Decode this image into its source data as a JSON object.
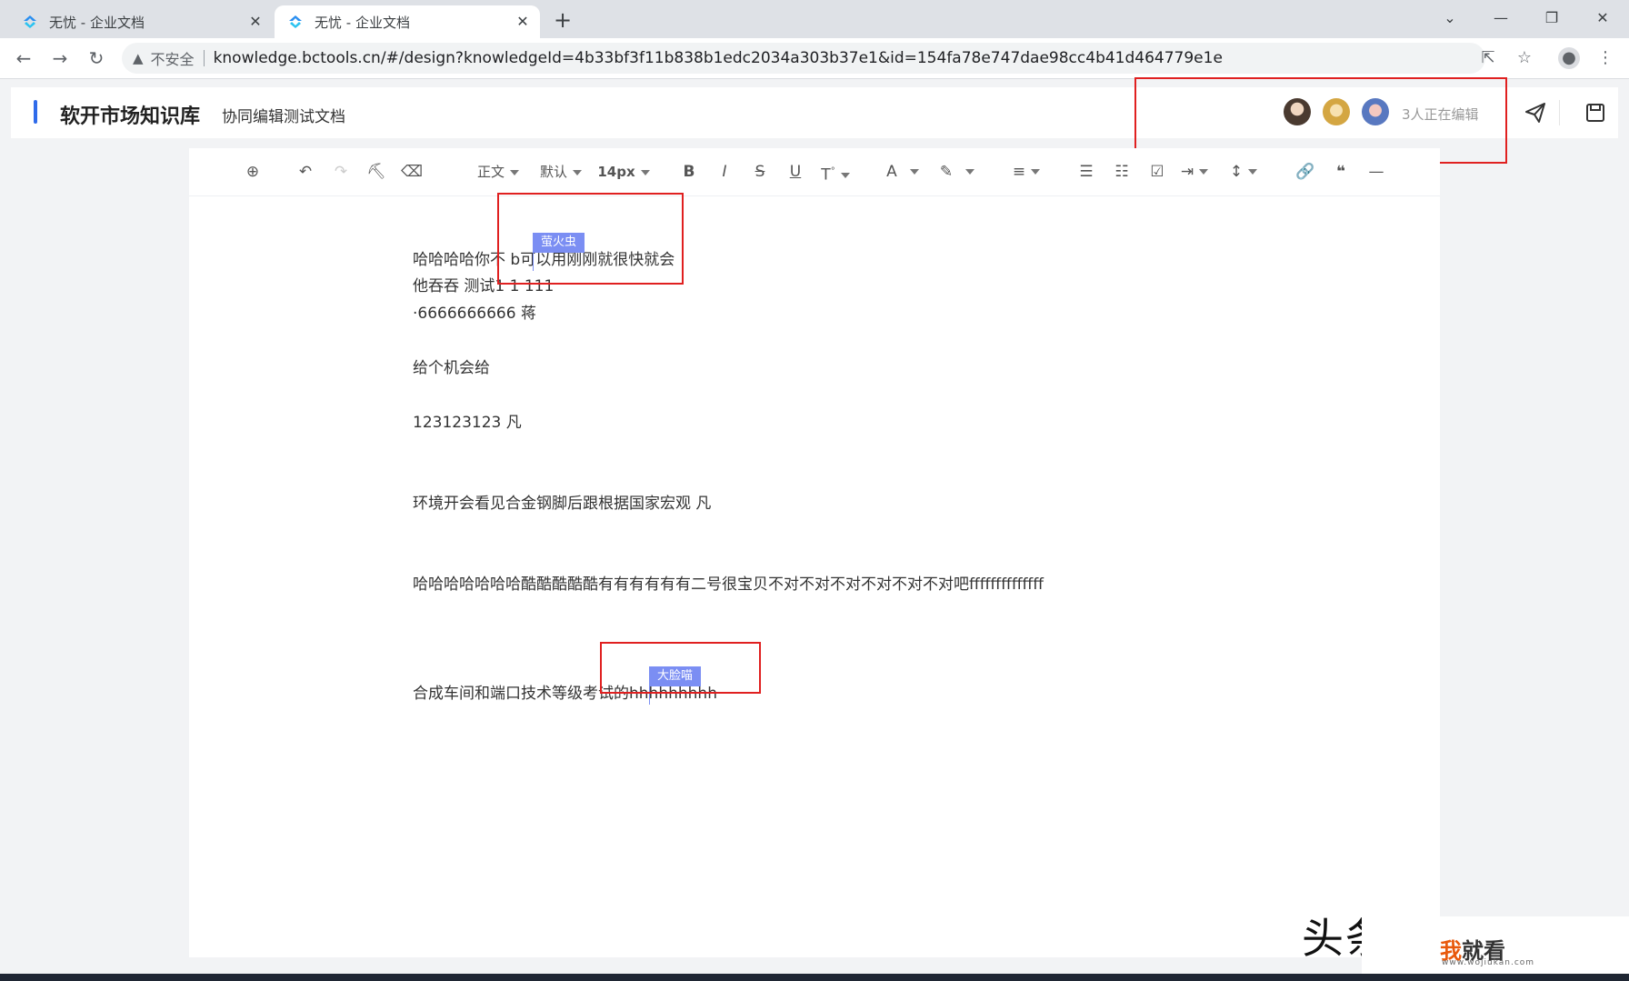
{
  "browser": {
    "tabs": [
      {
        "title": "无忧 - 企业文档",
        "active": false
      },
      {
        "title": "无忧 - 企业文档",
        "active": true
      }
    ],
    "new_tab_symbol": "+",
    "insecure_label": "不安全",
    "url": "knowledge.bctools.cn/#/design?knowledgeId=4b33bf3f11b838b1edc2034a303b37e1&id=154fa78e747dae98cc4b41d464779e1e"
  },
  "app": {
    "kb_name": "软开市场知识库",
    "doc_name": "协同编辑测试文档",
    "editing_status": "3人正在编辑",
    "accent_color": "#2f6bea"
  },
  "toolbar": {
    "paragraph_style": "正文",
    "font_family": "默认",
    "font_size": "14px"
  },
  "document": {
    "lines": [
      "哈哈哈哈你不 b可以用刚刚就很快就会",
      "他吞吞   测试1  1  111",
      "·6666666666  蒋",
      "给个机会给",
      "123123123    凡",
      "环境开会看见合金钢脚后跟根据国家宏观    凡",
      "哈哈哈哈哈哈哈酷酷酷酷酷有有有有有有二号很宝贝不对不对不对不对不对不对吧ffffffffffffff",
      "合成车间和端口技术等级考试的hhhhhhhhh"
    ]
  },
  "collaborators": {
    "cursors": [
      {
        "name": "萤火虫"
      },
      {
        "name": "大脸喵"
      }
    ],
    "cursor_color": "#7b8ef3"
  },
  "watermark": {
    "toutiao": "头条",
    "site_name_a": "我",
    "site_name_b": "就看",
    "site_url": "www.wojiukan.com"
  }
}
